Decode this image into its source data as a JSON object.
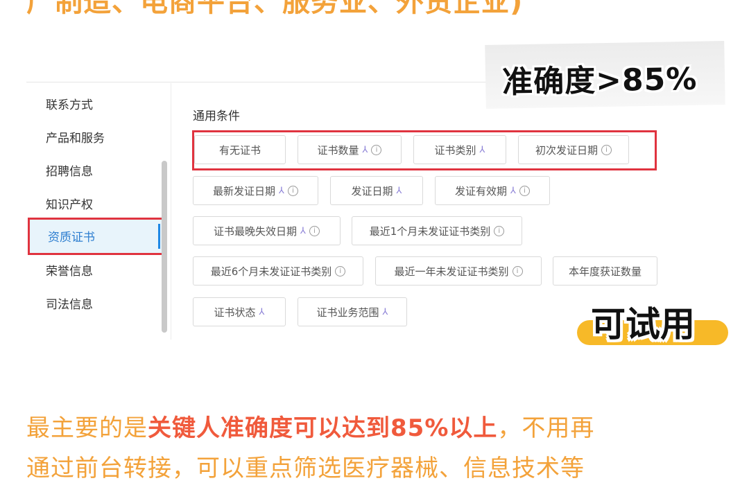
{
  "top_caption": "广制造、电商平台、服务业、外贸企业)",
  "sidebar": {
    "items": [
      {
        "label": "联系方式"
      },
      {
        "label": "产品和服务"
      },
      {
        "label": "招聘信息"
      },
      {
        "label": "知识产权"
      },
      {
        "label": "资质证书"
      },
      {
        "label": "荣誉信息"
      },
      {
        "label": "司法信息"
      }
    ],
    "active": "资质证书"
  },
  "section": {
    "title": "通用条件"
  },
  "chips": [
    {
      "label": "有无证书",
      "tree": false,
      "info": false
    },
    {
      "label": "证书数量",
      "tree": true,
      "info": true
    },
    {
      "label": "证书类别",
      "tree": true,
      "info": false
    },
    {
      "label": "初次发证日期",
      "tree": false,
      "info": true
    },
    {
      "label": "最新发证日期",
      "tree": true,
      "info": true
    },
    {
      "label": "发证日期",
      "tree": true,
      "info": false
    },
    {
      "label": "发证有效期",
      "tree": true,
      "info": true
    },
    {
      "label": "证书最晚失效日期",
      "tree": true,
      "info": true
    },
    {
      "label": "最近1个月未发证证书类别",
      "tree": false,
      "info": true
    },
    {
      "label": "最近6个月未发证证书类别",
      "tree": false,
      "info": true
    },
    {
      "label": "最近一年未发证证书类别",
      "tree": false,
      "info": true
    },
    {
      "label": "本年度获证数量",
      "tree": false,
      "info": false
    },
    {
      "label": "证书状态",
      "tree": true,
      "info": false
    },
    {
      "label": "证书业务范围",
      "tree": true,
      "info": false
    }
  ],
  "stickers": {
    "accuracy": "准确度>85%",
    "trial": "可试用"
  },
  "caption": {
    "prefix": "最主要的是",
    "highlight": "关键人准确度可以达到85%以上",
    "suffix": "，不用再",
    "line2": "通过前台转接，可以重点筛选医疗器械、信息技术等"
  },
  "colors": {
    "accent_orange": "#f3a23a",
    "highlight_red": "#f05a3c",
    "box_red": "#e0333f",
    "active_blue": "#2d7ed0"
  }
}
